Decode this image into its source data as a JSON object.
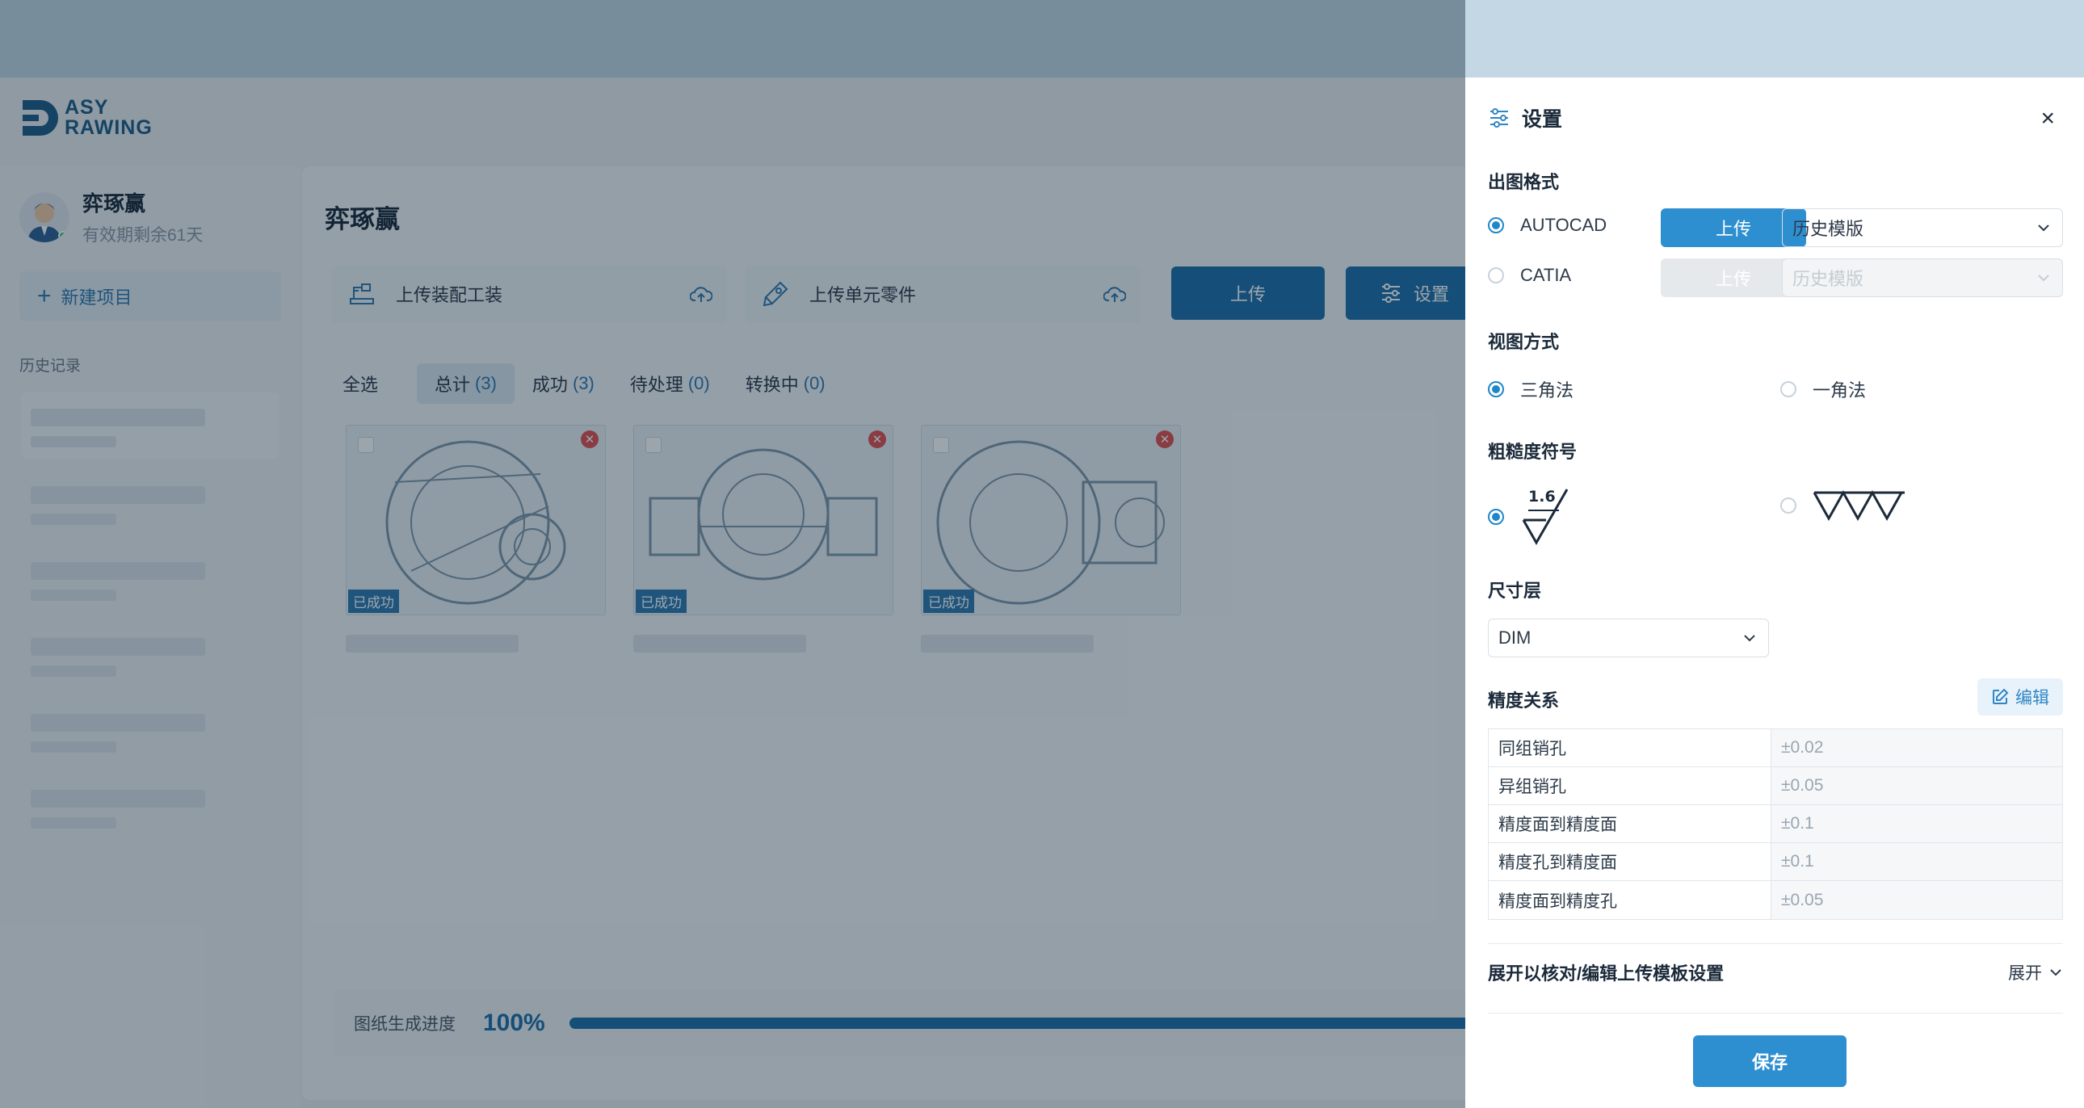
{
  "brand": {
    "line1": "ASY",
    "line2": "RAWING"
  },
  "user": {
    "name": "弈琢赢",
    "expiry": "有效期剩余61天"
  },
  "sidebar": {
    "new_project": "新建项目",
    "history_label": "历史记录"
  },
  "main": {
    "title": "弈琢赢",
    "upload_assembly": "上传装配工装",
    "upload_parts": "上传单元零件",
    "upload_button": "上传",
    "settings_button": "设置",
    "tabs": [
      {
        "label": "全选",
        "count": ""
      },
      {
        "label": "总计",
        "count": "(3)"
      },
      {
        "label": "成功",
        "count": "(3)"
      },
      {
        "label": "待处理",
        "count": "(0)"
      },
      {
        "label": "转换中",
        "count": "(0)"
      }
    ],
    "thumb_status": "已成功",
    "progress_label": "图纸生成进度",
    "progress_value": "100%",
    "progress_fraction": 1.0
  },
  "settings": {
    "title": "设置",
    "output_format_label": "出图格式",
    "formats": [
      {
        "name": "AUTOCAD",
        "selected": true,
        "upload": "上传",
        "template": "历史模版",
        "enabled": true
      },
      {
        "name": "CATIA",
        "selected": false,
        "upload": "上传",
        "template": "历史模版",
        "enabled": false
      }
    ],
    "view_label": "视图方式",
    "views": [
      {
        "name": "三角法",
        "selected": true
      },
      {
        "name": "一角法",
        "selected": false
      }
    ],
    "roughness_label": "粗糙度符号",
    "roughness_value": "1.6",
    "dim_layer_label": "尺寸层",
    "dim_layer_value": "DIM",
    "precision_label": "精度关系",
    "edit_label": "编辑",
    "precision_rows": [
      {
        "name": "同组销孔",
        "value": "±0.02"
      },
      {
        "name": "异组销孔",
        "value": "±0.05"
      },
      {
        "name": "精度面到精度面",
        "value": "±0.1"
      },
      {
        "name": "精度孔到精度面",
        "value": "±0.1"
      },
      {
        "name": "精度面到精度孔",
        "value": "±0.05"
      }
    ],
    "expand_text": "展开以核对/编辑上传模板设置",
    "expand_action": "展开",
    "save": "保存"
  },
  "colors": {
    "accent": "#2e8fd0",
    "primary_dark": "#1f6fa8",
    "success": "#33c069",
    "danger": "#e25050"
  }
}
